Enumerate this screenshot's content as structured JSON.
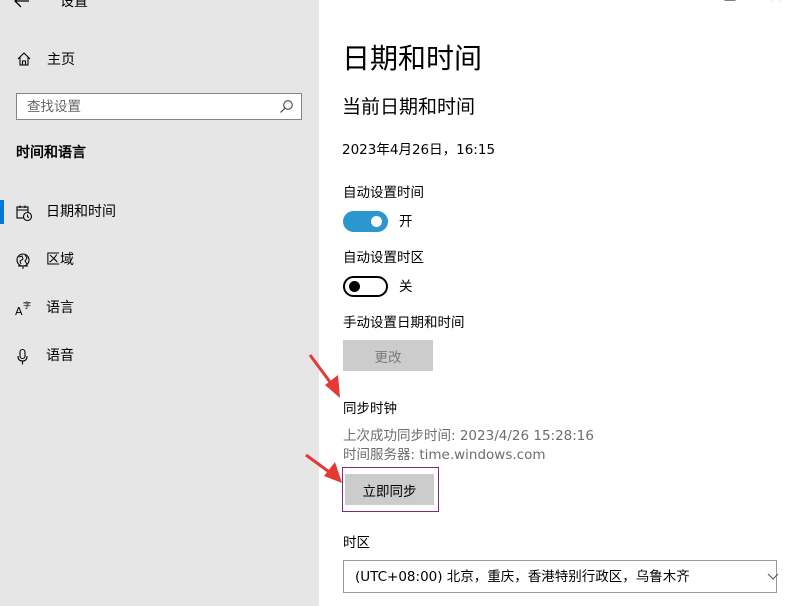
{
  "app": {
    "title": "设置",
    "window_controls": {
      "minimize": "—",
      "maximize": "☐",
      "close": "✕"
    }
  },
  "sidebar": {
    "home_label": "主页",
    "search_placeholder": "查找设置",
    "section_title": "时间和语言",
    "items": [
      {
        "label": "日期和时间",
        "icon": "calendar-clock-icon",
        "selected": true
      },
      {
        "label": "区域",
        "icon": "globe-icon",
        "selected": false
      },
      {
        "label": "语言",
        "icon": "language-icon",
        "selected": false
      },
      {
        "label": "语音",
        "icon": "microphone-icon",
        "selected": false
      }
    ]
  },
  "main": {
    "page_title": "日期和时间",
    "sub_title": "当前日期和时间",
    "current_datetime": "2023年4月26日，16:15",
    "auto_time": {
      "label": "自动设置时间",
      "state": "开",
      "on": true
    },
    "auto_timezone": {
      "label": "自动设置时区",
      "state": "关",
      "on": false
    },
    "manual": {
      "label": "手动设置日期和时间",
      "button": "更改"
    },
    "sync": {
      "title": "同步时钟",
      "last_sync": "上次成功同步时间: 2023/4/26 15:28:16",
      "server": "时间服务器: time.windows.com",
      "button": "立即同步"
    },
    "timezone": {
      "label": "时区",
      "value": "(UTC+08:00) 北京，重庆，香港特别行政区，乌鲁木齐"
    }
  },
  "colors": {
    "accent": "#0078d7",
    "toggle_on": "#2b97cf",
    "annotation_arrow": "#e53935",
    "highlight_border": "#7a2a80"
  }
}
